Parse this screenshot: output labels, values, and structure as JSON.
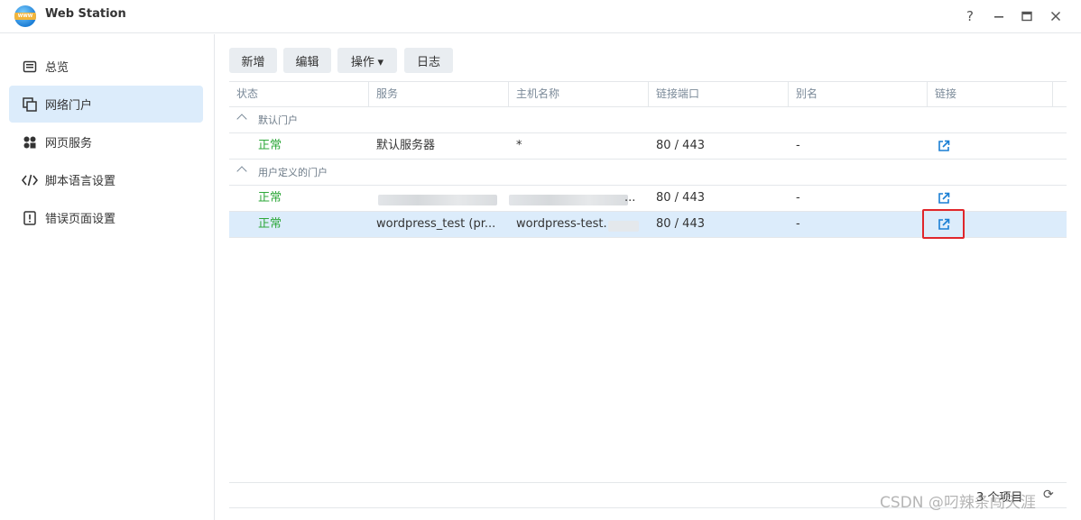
{
  "app": {
    "title": "Web Station",
    "icon": "www-globe-icon"
  },
  "window_controls": {
    "help": "?",
    "minimize": "−",
    "maximize": "□",
    "close": "✕"
  },
  "sidebar": {
    "items": [
      {
        "label": "总览",
        "icon": "overview-icon",
        "active": false
      },
      {
        "label": "网络门户",
        "icon": "web-portal-icon",
        "active": true
      },
      {
        "label": "网页服务",
        "icon": "web-service-icon",
        "active": false
      },
      {
        "label": "脚本语言设置",
        "icon": "code-icon",
        "active": false
      },
      {
        "label": "错误页面设置",
        "icon": "error-page-icon",
        "active": false
      }
    ]
  },
  "toolbar": {
    "create": "新增",
    "edit": "编辑",
    "action": "操作 ▾",
    "log": "日志"
  },
  "table": {
    "columns": [
      "状态",
      "服务",
      "主机名称",
      "链接端口",
      "别名",
      "链接"
    ],
    "groups": [
      {
        "label": "默认门户",
        "rows": [
          {
            "status": "正常",
            "service": "默认服务器",
            "hostname": "*",
            "port": "80 / 443",
            "alias": "-"
          }
        ]
      },
      {
        "label": "用户定义的门户",
        "rows": [
          {
            "status": "正常",
            "service": "",
            "hostname": "...",
            "port": "80 / 443",
            "alias": "-"
          },
          {
            "status": "正常",
            "service": "wordpress_test (pr...",
            "hostname": "wordpress-test.",
            "port": "80 / 443",
            "alias": "-"
          }
        ]
      }
    ]
  },
  "footer": {
    "count": "3 个项目",
    "refresh_icon": "refresh-icon"
  },
  "watermark": "CSDN @叼辣条闯天涯",
  "colors": {
    "status_ok": "#2ea83a",
    "selected_row": "#dcecfb",
    "link_icon": "#1a7fd4",
    "highlight": "#e0262b"
  }
}
